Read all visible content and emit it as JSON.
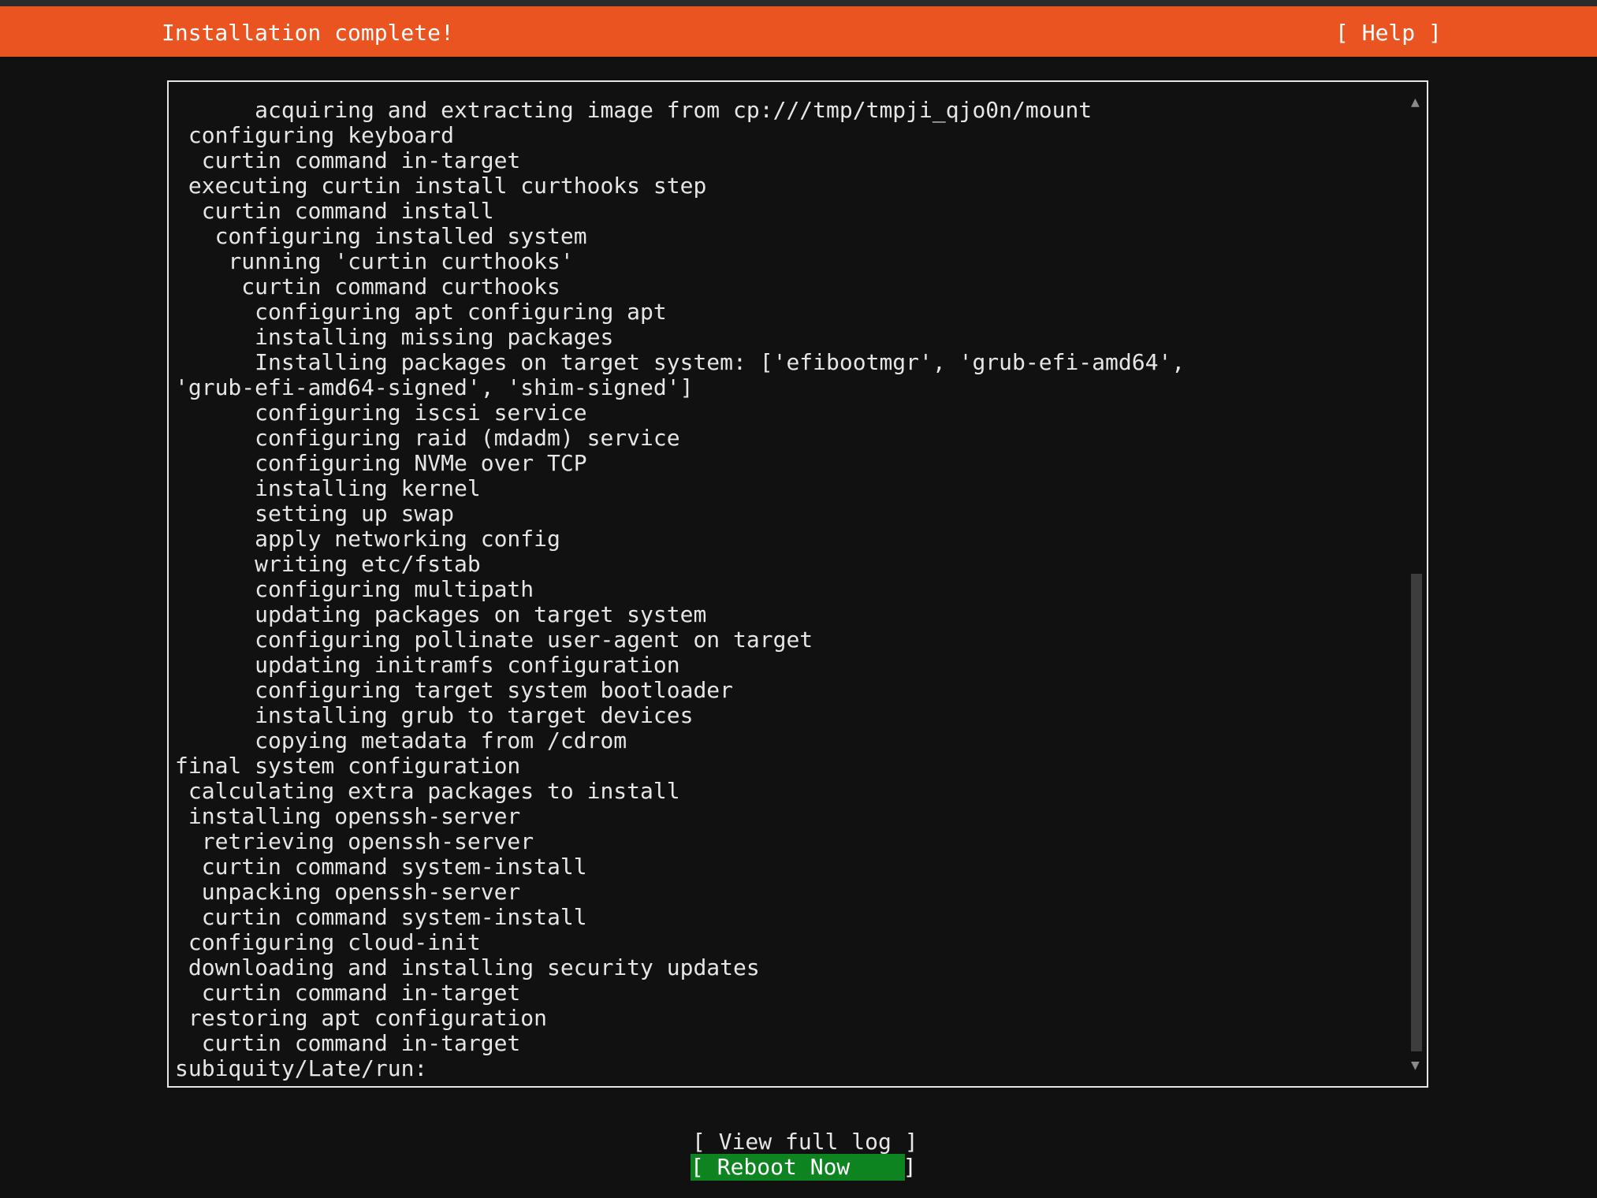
{
  "header": {
    "title": "Installation complete!",
    "help_label": "[ Help ]"
  },
  "log": {
    "lines": [
      "      acquiring and extracting image from cp:///tmp/tmpji_qjo0n/mount",
      " configuring keyboard",
      "  curtin command in-target",
      " executing curtin install curthooks step",
      "  curtin command install",
      "   configuring installed system",
      "    running 'curtin curthooks'",
      "     curtin command curthooks",
      "      configuring apt configuring apt",
      "      installing missing packages",
      "      Installing packages on target system: ['efibootmgr', 'grub-efi-amd64',",
      "'grub-efi-amd64-signed', 'shim-signed']",
      "      configuring iscsi service",
      "      configuring raid (mdadm) service",
      "      configuring NVMe over TCP",
      "      installing kernel",
      "      setting up swap",
      "      apply networking config",
      "      writing etc/fstab",
      "      configuring multipath",
      "      updating packages on target system",
      "      configuring pollinate user-agent on target",
      "      updating initramfs configuration",
      "      configuring target system bootloader",
      "      installing grub to target devices",
      "      copying metadata from /cdrom",
      "final system configuration",
      " calculating extra packages to install",
      " installing openssh-server",
      "  retrieving openssh-server",
      "  curtin command system-install",
      "  unpacking openssh-server",
      "  curtin command system-install",
      " configuring cloud-init",
      " downloading and installing security updates",
      "  curtin command in-target",
      " restoring apt configuration",
      "  curtin command in-target",
      "subiquity/Late/run:"
    ],
    "scroll_up_glyph": "▲",
    "scroll_down_glyph": "▼"
  },
  "buttons": {
    "view_log_label": "[ View full log ]",
    "reboot_label": "[ Reboot Now    ]"
  },
  "colors": {
    "header_bg": "#e95420",
    "background": "#111111",
    "reboot_bg": "#0e8420",
    "text": "#e6e6e6"
  }
}
